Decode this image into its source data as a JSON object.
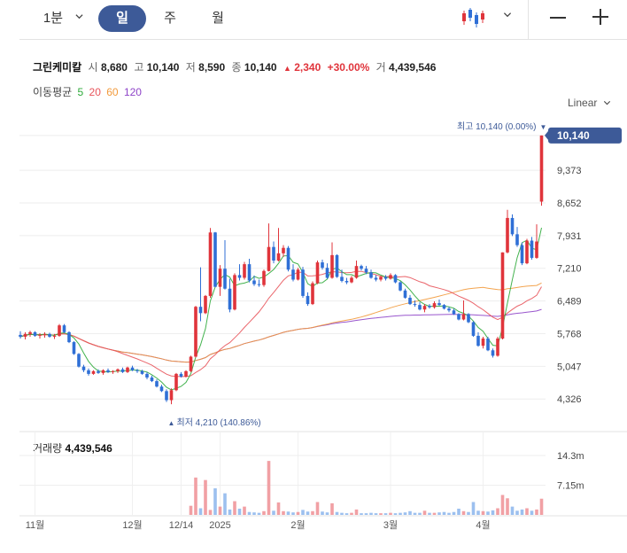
{
  "toolbar": {
    "interval_label": "1분",
    "tabs": [
      {
        "label": "일",
        "active": true
      },
      {
        "label": "주",
        "active": false
      },
      {
        "label": "월",
        "active": false
      }
    ],
    "accent_color": "#3d5a98",
    "chart_type_icon": "candlestick-icon",
    "zoom_out_icon": "minus-icon",
    "zoom_in_icon": "plus-icon"
  },
  "quote": {
    "name": "그린케미칼",
    "open_label": "시",
    "open": "8,680",
    "high_label": "고",
    "high": "10,140",
    "low_label": "저",
    "low": "8,590",
    "close_label": "종",
    "close": "10,140",
    "change_arrow": "▲",
    "change": "2,340",
    "change_pct": "+30.00%",
    "volume_label": "거",
    "volume": "4,439,546"
  },
  "moving_average": {
    "label": "이동평균",
    "periods": [
      {
        "value": "5",
        "color": "#2eaa3a"
      },
      {
        "value": "20",
        "color": "#e8545b"
      },
      {
        "value": "60",
        "color": "#f29a3c"
      },
      {
        "value": "120",
        "color": "#8e44c8"
      }
    ]
  },
  "scale_mode": "Linear",
  "annotations": {
    "high_label": "최고 10,140 (0.00%)",
    "high_marker": "▼",
    "low_label": "최저 4,210 (140.86%)",
    "low_marker": "▲",
    "current_price": "10,140"
  },
  "volume_panel": {
    "title": "거래량",
    "value": "4,439,546"
  },
  "colors": {
    "up": "#e0343b",
    "down": "#2f6fd6",
    "vol_up": "#f1a0a4",
    "vol_down": "#9cc0ef",
    "grid": "#eeeeee"
  },
  "chart_data": {
    "type": "candlestick",
    "y_ticks": [
      "10,140",
      "9,373",
      "8,652",
      "7,931",
      "7,210",
      "6,489",
      "5,768",
      "5,047",
      "4,326"
    ],
    "y_tick_values": [
      10140,
      9373,
      8652,
      7931,
      7210,
      6489,
      5768,
      5047,
      4326
    ],
    "ylim": [
      3900,
      10450
    ],
    "volume_ticks": [
      "14.3m",
      "7.15m"
    ],
    "volume_tick_values": [
      14300000,
      7150000
    ],
    "volume_max": 19000000,
    "x_labels": [
      {
        "label": "11월",
        "index": 3
      },
      {
        "label": "12월",
        "index": 23
      },
      {
        "label": "12/14",
        "index": 33
      },
      {
        "label": "2025",
        "index": 41
      },
      {
        "label": "2월",
        "index": 57
      },
      {
        "label": "3월",
        "index": 76
      },
      {
        "label": "4월",
        "index": 95
      }
    ],
    "ohlc": [
      [
        5740,
        5820,
        5660,
        5700
      ],
      [
        5700,
        5800,
        5640,
        5760
      ],
      [
        5760,
        5830,
        5700,
        5800
      ],
      [
        5800,
        5820,
        5700,
        5720
      ],
      [
        5720,
        5780,
        5660,
        5740
      ],
      [
        5740,
        5800,
        5680,
        5760
      ],
      [
        5760,
        5790,
        5680,
        5700
      ],
      [
        5700,
        5760,
        5650,
        5720
      ],
      [
        5720,
        5980,
        5700,
        5950
      ],
      [
        5950,
        5980,
        5780,
        5800
      ],
      [
        5800,
        5820,
        5560,
        5580
      ],
      [
        5580,
        5600,
        5300,
        5320
      ],
      [
        5320,
        5340,
        5020,
        5040
      ],
      [
        5040,
        5080,
        4920,
        4960
      ],
      [
        4960,
        5000,
        4840,
        4880
      ],
      [
        4880,
        4960,
        4860,
        4940
      ],
      [
        4940,
        4980,
        4880,
        4900
      ],
      [
        4900,
        4980,
        4860,
        4960
      ],
      [
        4960,
        5000,
        4900,
        4920
      ],
      [
        4920,
        4960,
        4880,
        4940
      ],
      [
        4940,
        5000,
        4900,
        4980
      ],
      [
        4980,
        5020,
        4900,
        4920
      ],
      [
        4920,
        5040,
        4900,
        5020
      ],
      [
        5020,
        5060,
        4940,
        4960
      ],
      [
        4960,
        4990,
        4900,
        4940
      ],
      [
        4940,
        4970,
        4860,
        4880
      ],
      [
        4880,
        4920,
        4760,
        4800
      ],
      [
        4800,
        4840,
        4700,
        4720
      ],
      [
        4720,
        4760,
        4580,
        4600
      ],
      [
        4600,
        4640,
        4480,
        4500
      ],
      [
        4500,
        4540,
        4260,
        4300
      ],
      [
        4300,
        4560,
        4210,
        4520
      ],
      [
        4520,
        4900,
        4500,
        4880
      ],
      [
        4880,
        4920,
        4800,
        4820
      ],
      [
        4820,
        4960,
        4800,
        4940
      ],
      [
        4940,
        5280,
        4920,
        5260
      ],
      [
        5260,
        6380,
        5240,
        6360
      ],
      [
        6360,
        7230,
        6040,
        6220
      ],
      [
        6220,
        6620,
        6200,
        6600
      ],
      [
        6600,
        8100,
        6560,
        8000
      ],
      [
        8000,
        8010,
        6790,
        6800
      ],
      [
        6800,
        7280,
        6600,
        7200
      ],
      [
        7200,
        7830,
        6740,
        6760
      ],
      [
        6760,
        6980,
        6240,
        6300
      ],
      [
        6300,
        7100,
        6280,
        7060
      ],
      [
        7060,
        7300,
        6940,
        7000
      ],
      [
        7000,
        7350,
        6960,
        7300
      ],
      [
        7300,
        7420,
        6900,
        6940
      ],
      [
        6940,
        7050,
        6820,
        6860
      ],
      [
        6860,
        6960,
        6800,
        6840
      ],
      [
        6840,
        7180,
        6800,
        7150
      ],
      [
        7150,
        8200,
        7140,
        7680
      ],
      [
        7680,
        7800,
        7320,
        7380
      ],
      [
        7380,
        8100,
        7360,
        7540
      ],
      [
        7540,
        7720,
        7460,
        7660
      ],
      [
        7660,
        7700,
        7140,
        7180
      ],
      [
        7180,
        7300,
        6920,
        6960
      ],
      [
        6960,
        7220,
        6940,
        7180
      ],
      [
        7180,
        7240,
        6560,
        6600
      ],
      [
        6600,
        6680,
        6380,
        6420
      ],
      [
        6420,
        6920,
        6400,
        6880
      ],
      [
        6880,
        7380,
        6860,
        7340
      ],
      [
        7340,
        7400,
        7180,
        7220
      ],
      [
        7220,
        7320,
        6980,
        7000
      ],
      [
        7000,
        7780,
        6980,
        7500
      ],
      [
        7500,
        7520,
        7000,
        7020
      ],
      [
        7020,
        7180,
        6900,
        6930
      ],
      [
        6930,
        7000,
        6860,
        6900
      ],
      [
        6900,
        7040,
        6880,
        7000
      ],
      [
        7000,
        7380,
        6980,
        7260
      ],
      [
        7260,
        7290,
        7160,
        7200
      ],
      [
        7200,
        7260,
        7080,
        7120
      ],
      [
        7120,
        7180,
        6980,
        7000
      ],
      [
        7000,
        7060,
        6920,
        6960
      ],
      [
        6960,
        7040,
        6920,
        7020
      ],
      [
        7020,
        7060,
        6940,
        6980
      ],
      [
        6980,
        7100,
        6960,
        7060
      ],
      [
        7060,
        7080,
        6880,
        6900
      ],
      [
        6900,
        6920,
        6700,
        6720
      ],
      [
        6720,
        6760,
        6540,
        6560
      ],
      [
        6560,
        6620,
        6400,
        6420
      ],
      [
        6420,
        6500,
        6360,
        6400
      ],
      [
        6400,
        6460,
        6280,
        6300
      ],
      [
        6300,
        6420,
        6240,
        6380
      ],
      [
        6380,
        6420,
        6320,
        6350
      ],
      [
        6350,
        6480,
        6320,
        6440
      ],
      [
        6440,
        6520,
        6380,
        6400
      ],
      [
        6400,
        6420,
        6300,
        6320
      ],
      [
        6320,
        6360,
        6240,
        6280
      ],
      [
        6280,
        6320,
        6180,
        6200
      ],
      [
        6200,
        6220,
        6060,
        6080
      ],
      [
        6080,
        6500,
        6060,
        6200
      ],
      [
        6200,
        6220,
        6000,
        6020
      ],
      [
        6020,
        6040,
        5700,
        5720
      ],
      [
        5720,
        5800,
        5480,
        5500
      ],
      [
        5500,
        5700,
        5440,
        5660
      ],
      [
        5660,
        5700,
        5380,
        5400
      ],
      [
        5400,
        5440,
        5240,
        5280
      ],
      [
        5280,
        5700,
        5260,
        5660
      ],
      [
        5660,
        7560,
        5640,
        7560
      ],
      [
        7560,
        8500,
        7540,
        8320
      ],
      [
        8320,
        8400,
        7920,
        7960
      ],
      [
        7960,
        8120,
        7680,
        7720
      ],
      [
        7720,
        7780,
        7280,
        7320
      ],
      [
        7320,
        7860,
        7300,
        7820
      ],
      [
        7820,
        7900,
        7400,
        7440
      ],
      [
        7440,
        8180,
        7420,
        7800
      ],
      [
        8680,
        10140,
        8590,
        10140
      ]
    ],
    "volume": [
      0,
      0,
      0,
      0,
      0,
      0,
      0,
      0,
      0,
      0,
      0,
      0,
      0,
      0,
      0,
      0,
      0,
      0,
      0,
      0,
      0,
      0,
      0,
      0,
      0,
      0,
      0,
      0,
      0,
      0,
      0,
      0,
      0,
      0,
      0,
      2200000,
      9000000,
      1600000,
      8400000,
      1200000,
      6400000,
      2000000,
      5200000,
      1300000,
      3300000,
      1500000,
      2000000,
      700000,
      600000,
      500000,
      900000,
      13000000,
      1000000,
      3000000,
      900000,
      800000,
      600000,
      700000,
      1200000,
      800000,
      900000,
      3100000,
      800000,
      600000,
      2800000,
      700000,
      500000,
      400000,
      500000,
      1300000,
      400000,
      400000,
      500000,
      400000,
      400000,
      400000,
      500000,
      400000,
      500000,
      600000,
      900000,
      500000,
      500000,
      1000000,
      500000,
      500000,
      600000,
      700000,
      500000,
      700000,
      1500000,
      900000,
      700000,
      3100000,
      1000000,
      900000,
      800000,
      1100000,
      1600000,
      4800000,
      4000000,
      2000000,
      1000000,
      1300000,
      1600000,
      1000000,
      1300000,
      3900000
    ]
  }
}
